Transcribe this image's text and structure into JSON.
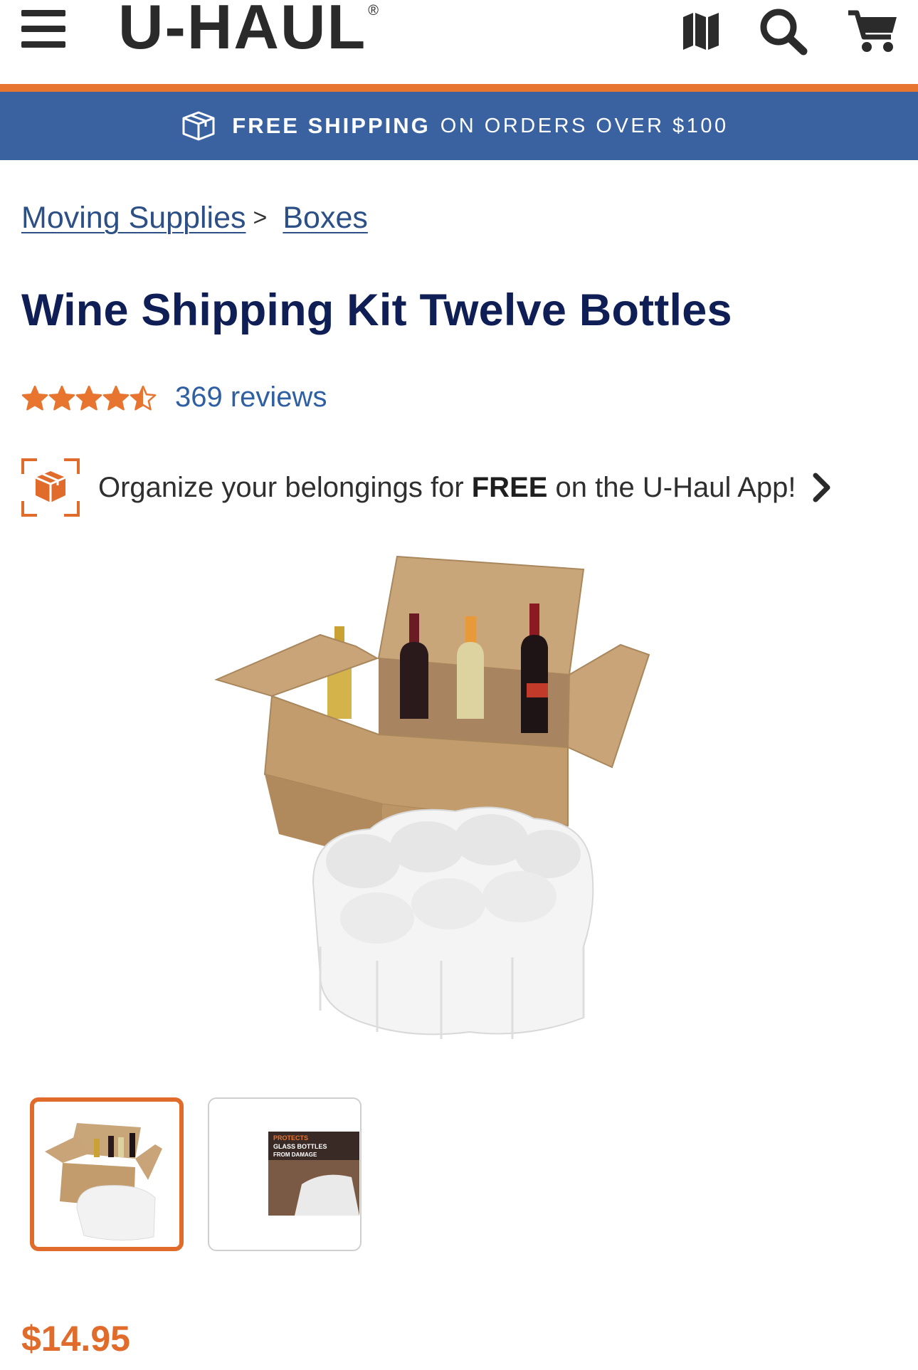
{
  "header": {
    "logo_text": "U-HAUL",
    "logo_registered": "®",
    "icons": [
      "menu-icon",
      "map-icon",
      "search-icon",
      "cart-icon"
    ]
  },
  "promo": {
    "icon": "box-icon",
    "bold": "FREE SHIPPING",
    "rest": "ON ORDERS OVER $100"
  },
  "breadcrumb": {
    "items": [
      {
        "label": "Moving Supplies"
      },
      {
        "label": "Boxes"
      }
    ],
    "separator": ">"
  },
  "product": {
    "title": "Wine Shipping Kit Twelve Bottles",
    "rating": 4.5,
    "rating_max": 5,
    "reviews": "369 reviews",
    "price": "$14.95"
  },
  "app_promo": {
    "prefix": "Organize your belongings for ",
    "bold": "FREE",
    "suffix": " on the U-Haul  App!"
  },
  "gallery": {
    "thumbnails": [
      {
        "selected": true
      },
      {
        "selected": false,
        "overlay_text": "PROTECTS GLASS BOTTLES FROM DAMAGE"
      }
    ]
  },
  "colors": {
    "accent_orange": "#e8752f",
    "promo_blue": "#3a62a0",
    "title_navy": "#0f1f55",
    "link_blue": "#2c4f86",
    "price_orange": "#e06b2a"
  }
}
